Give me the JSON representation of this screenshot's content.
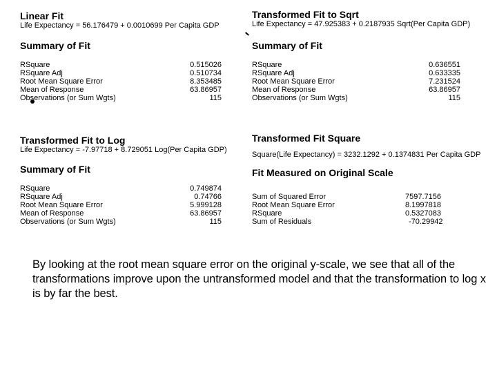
{
  "panels": {
    "linear": {
      "title": "Linear Fit",
      "equation": "Life Expectancy = 56.176479 + 0.0010699 Per Capita GDP",
      "summary_title": "Summary of Fit",
      "rows": [
        {
          "label": "RSquare",
          "value": "0.515026"
        },
        {
          "label": "RSquare Adj",
          "value": "0.510734"
        },
        {
          "label": "Root Mean Square Error",
          "value": "8.353485"
        },
        {
          "label": "Mean of Response",
          "value": "63.86957"
        },
        {
          "label": "Observations (or Sum Wgts)",
          "value": "115"
        }
      ]
    },
    "sqrt": {
      "title": "Transformed Fit to Sqrt",
      "equation": "Life Expectancy = 47.925383 + 0.2187935 Sqrt(Per Capita GDP)",
      "summary_title": "Summary of Fit",
      "rows": [
        {
          "label": "RSquare",
          "value": "0.636551"
        },
        {
          "label": "RSquare Adj",
          "value": "0.633335"
        },
        {
          "label": "Root Mean Square Error",
          "value": "7.231524"
        },
        {
          "label": "Mean of Response",
          "value": "63.86957"
        },
        {
          "label": "Observations (or Sum Wgts)",
          "value": "115"
        }
      ]
    },
    "log": {
      "title": "Transformed Fit to Log",
      "equation": "Life Expectancy = -7.97718 + 8.729051 Log(Per Capita GDP)",
      "summary_title": "Summary of Fit",
      "rows": [
        {
          "label": "RSquare",
          "value": "0.749874"
        },
        {
          "label": "RSquare Adj",
          "value": "0.74766"
        },
        {
          "label": "Root Mean Square Error",
          "value": "5.999128"
        },
        {
          "label": "Mean of Response",
          "value": "63.86957"
        },
        {
          "label": "Observations (or Sum Wgts)",
          "value": "115"
        }
      ]
    },
    "square": {
      "title": "Transformed Fit Square",
      "equation": "Square(Life Expectancy) = 3232.1292 + 0.1374831 Per Capita GDP",
      "summary_title": "Fit Measured on Original Scale",
      "rows": [
        {
          "label": "Sum of Squared Error",
          "value": "7597.7156"
        },
        {
          "label": "Root Mean Square Error",
          "value": "8.1997818"
        },
        {
          "label": "RSquare",
          "value": "0.5327083"
        },
        {
          "label": "Sum of Residuals",
          "value": "-70.29942"
        }
      ]
    }
  },
  "conclusion": "By looking at the root mean square error on the original y-scale, we see that all of the transformations improve upon the untransformed model and that the transformation to log x is by far the best."
}
